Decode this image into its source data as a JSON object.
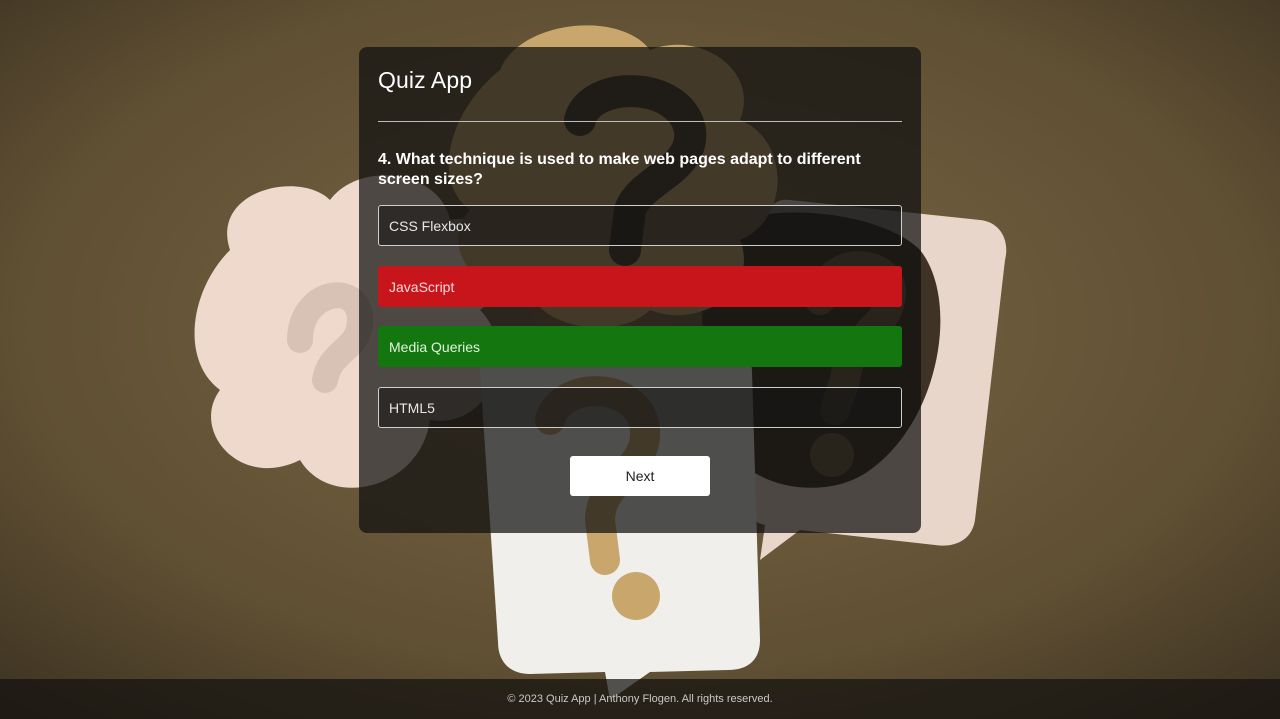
{
  "app": {
    "title": "Quiz App"
  },
  "question": {
    "text": "4. What technique is used to make web pages adapt to different screen sizes?"
  },
  "answers": [
    {
      "label": "CSS Flexbox",
      "state": "neutral"
    },
    {
      "label": "JavaScript",
      "state": "wrong"
    },
    {
      "label": "Media Queries",
      "state": "correct"
    },
    {
      "label": "HTML5",
      "state": "neutral"
    }
  ],
  "controls": {
    "next_label": "Next"
  },
  "footer": {
    "text": "© 2023 Quiz App | Anthony Flogen. All rights reserved."
  },
  "colors": {
    "wrong": "#c8151b",
    "correct": "#14760f",
    "card_bg": "rgba(15,15,15,0.72)"
  }
}
